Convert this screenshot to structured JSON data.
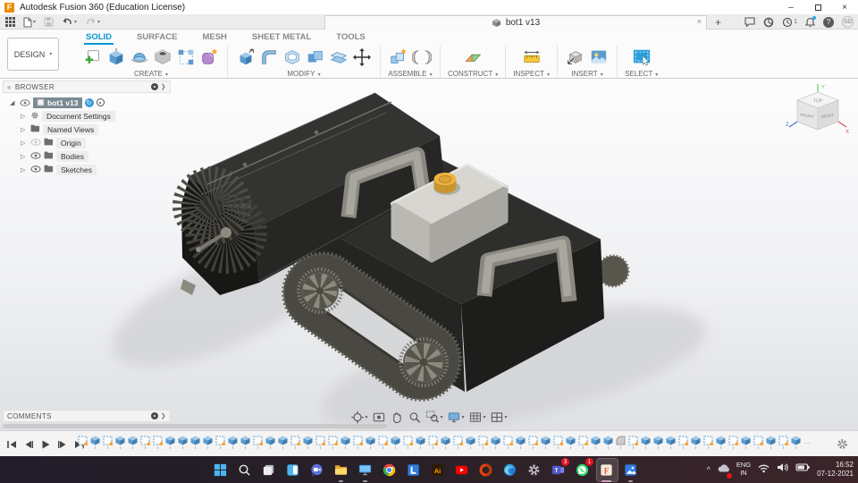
{
  "window": {
    "title": "Autodesk Fusion 360 (Education License)",
    "minimize": "–",
    "maximize": "",
    "close": "×"
  },
  "appbar": {
    "tab_label": "bot1 v13",
    "tab_close": "×",
    "new_tab": "+",
    "job_badge": "1",
    "avatar": "SD",
    "help": "?"
  },
  "ribbon": {
    "design_label": "DESIGN",
    "caret": "▾",
    "tabs": [
      {
        "label": "SOLID",
        "active": true
      },
      {
        "label": "SURFACE",
        "active": false
      },
      {
        "label": "MESH",
        "active": false
      },
      {
        "label": "SHEET METAL",
        "active": false
      },
      {
        "label": "TOOLS",
        "active": false
      }
    ],
    "groups": [
      {
        "label": "CREATE",
        "icons": [
          "create-sketch-icon",
          "extrude-icon",
          "revolve-icon",
          "hole-icon",
          "pattern-icon",
          "form-icon"
        ]
      },
      {
        "label": "MODIFY",
        "icons": [
          "press-pull-icon",
          "fillet-icon",
          "shell-icon",
          "combine-icon",
          "offset-face-icon",
          "move-icon"
        ]
      },
      {
        "label": "ASSEMBLE",
        "icons": [
          "new-component-icon",
          "joint-icon"
        ]
      },
      {
        "label": "CONSTRUCT",
        "icons": [
          "construct-plane-icon"
        ]
      },
      {
        "label": "INSPECT",
        "icons": [
          "measure-icon"
        ]
      },
      {
        "label": "INSERT",
        "icons": [
          "insert-mesh-icon",
          "canvas-icon"
        ]
      },
      {
        "label": "SELECT",
        "icons": [
          "select-icon"
        ]
      }
    ]
  },
  "browser": {
    "header": "BROWSER",
    "collapse": "«",
    "root_label": "bot1 v13",
    "items": [
      {
        "icon": "gear",
        "label": "Document Settings",
        "eye": "none"
      },
      {
        "icon": "folder",
        "label": "Named Views",
        "eye": "none"
      },
      {
        "icon": "folder",
        "label": "Origin",
        "eye": "dim"
      },
      {
        "icon": "folder",
        "label": "Bodies",
        "eye": "on"
      },
      {
        "icon": "folder",
        "label": "Sketches",
        "eye": "on"
      }
    ]
  },
  "comments": {
    "header": "COMMENTS"
  },
  "viewcube": {
    "top": "TOP",
    "front": "FRONT",
    "right": "RIGHT",
    "axis_x": "X",
    "axis_y": "Y",
    "axis_z": "Z",
    "axis_colors": {
      "x": "#d9534f",
      "y": "#6abf69",
      "z": "#4a6fd4"
    }
  },
  "navbar": {
    "items": [
      {
        "icon": "orbit-icon",
        "caret": true
      },
      {
        "icon": "look-at-icon",
        "caret": false
      },
      {
        "icon": "pan-icon",
        "caret": false
      },
      {
        "icon": "zoom-icon",
        "caret": false
      },
      {
        "icon": "fit-icon",
        "caret": true
      },
      {
        "icon": "display-settings-icon",
        "caret": true
      },
      {
        "icon": "grid-settings-icon",
        "caret": true
      },
      {
        "icon": "viewports-icon",
        "caret": true
      }
    ]
  },
  "timeline": {
    "playback": [
      "go-to-start",
      "step-back",
      "play",
      "step-forward",
      "go-to-end"
    ],
    "features": [
      "sketch",
      "extrude",
      "sketch",
      "extrude",
      "extrude",
      "sketch",
      "sketch",
      "extrude",
      "extrude",
      "extrude",
      "extrude",
      "sketch",
      "extrude",
      "extrude",
      "sketch",
      "extrude",
      "extrude",
      "sketch",
      "extrude",
      "sketch",
      "sketch",
      "extrude",
      "sketch",
      "extrude",
      "sketch",
      "extrude",
      "sketch",
      "extrude",
      "sketch",
      "extrude",
      "sketch",
      "extrude",
      "sketch",
      "extrude",
      "sketch",
      "extrude",
      "sketch",
      "extrude",
      "sketch",
      "extrude",
      "sketch",
      "extrude",
      "extrude",
      "fillet",
      "sketch",
      "extrude",
      "extrude",
      "extrude",
      "sketch",
      "extrude",
      "sketch",
      "extrude",
      "sketch",
      "extrude",
      "sketch",
      "extrude",
      "sketch",
      "extrude"
    ],
    "ellipsis": "…"
  },
  "taskbar": {
    "apps": [
      {
        "name": "start"
      },
      {
        "name": "search"
      },
      {
        "name": "task-view"
      },
      {
        "name": "widgets"
      },
      {
        "name": "chat"
      },
      {
        "name": "file-explorer",
        "indicator": true
      },
      {
        "name": "display-app",
        "indicator": true
      },
      {
        "name": "chrome"
      },
      {
        "name": "l-app"
      },
      {
        "name": "illustrator"
      },
      {
        "name": "youtube"
      },
      {
        "name": "office"
      },
      {
        "name": "edge"
      },
      {
        "name": "settings"
      },
      {
        "name": "teams",
        "badge": "3"
      },
      {
        "name": "whatsapp",
        "badge": "1"
      },
      {
        "name": "fusion-360",
        "active": true
      },
      {
        "name": "photos",
        "indicator": true
      }
    ],
    "tray": {
      "chevron": "^",
      "language_line1": "ENG",
      "language_line2": "IN",
      "time": "16:52",
      "date": "07-12-2021"
    }
  },
  "colors": {
    "accent_blue": "#0696d7",
    "fusion_orange": "#f18a00",
    "selection_gray": "#7b8a93",
    "model_body": "#2e2e2c",
    "model_metal": "#a9a7a1",
    "model_button_orange": "#f0b446",
    "taskbar_badge_red": "#e81123"
  }
}
